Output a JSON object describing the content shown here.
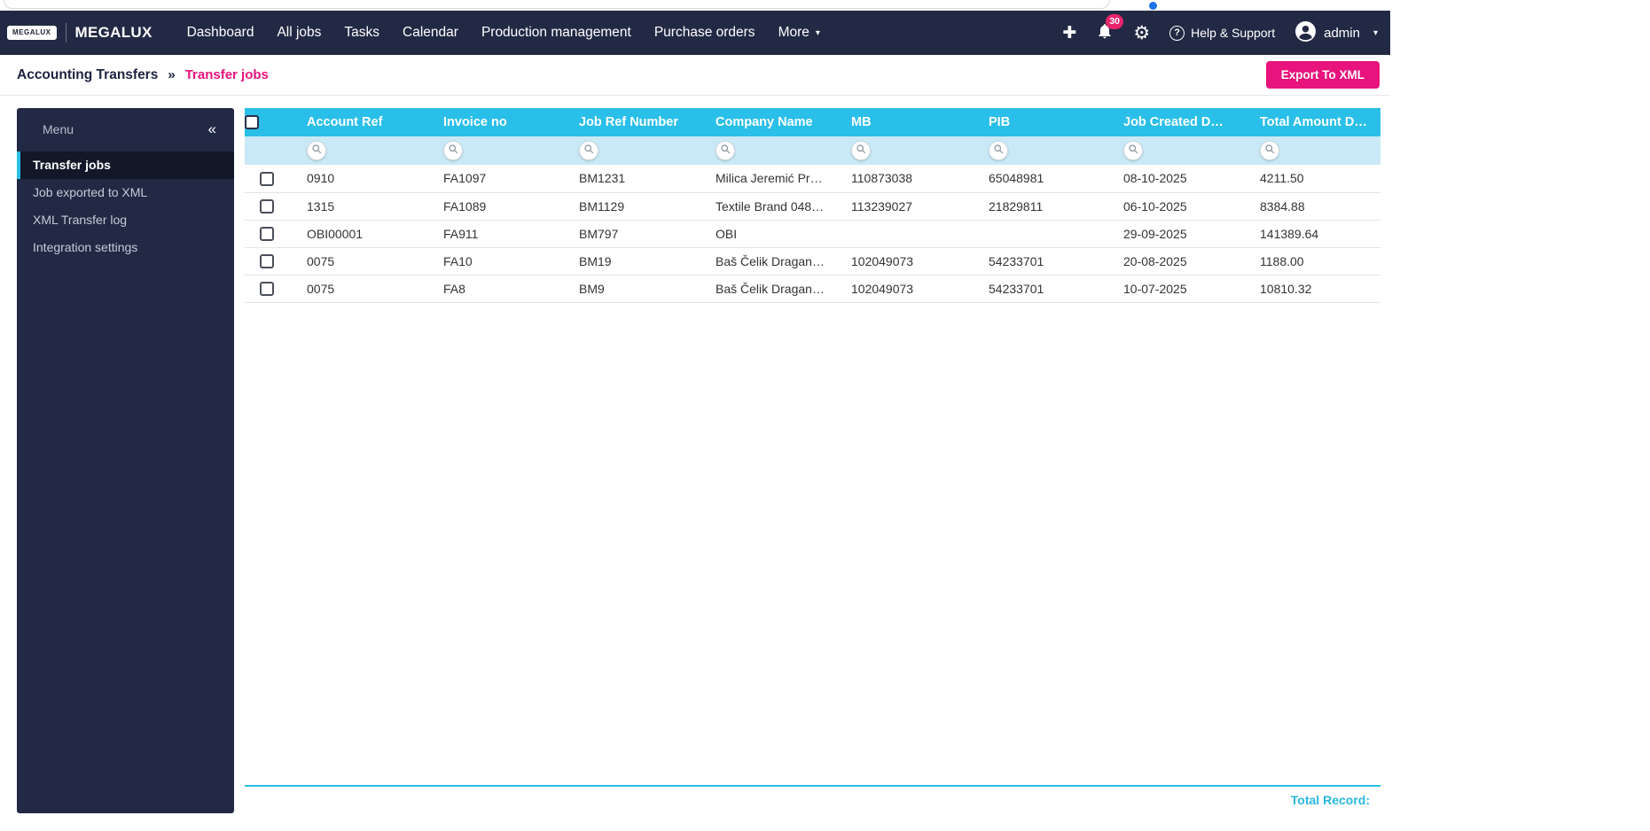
{
  "icons": {
    "plus": "✚",
    "gear": "⚙",
    "chevron_down": "▾",
    "collapse": "«",
    "breadcrumb_sep": "»",
    "help": "?"
  },
  "navbar": {
    "logo_badge": "MEGALUX",
    "brand": "MEGALUX",
    "items": [
      {
        "id": "dashboard",
        "label": "Dashboard"
      },
      {
        "id": "all-jobs",
        "label": "All jobs"
      },
      {
        "id": "tasks",
        "label": "Tasks"
      },
      {
        "id": "calendar",
        "label": "Calendar"
      },
      {
        "id": "production-management",
        "label": "Production management"
      },
      {
        "id": "purchase-orders",
        "label": "Purchase orders"
      },
      {
        "id": "more",
        "label": "More",
        "chevron": true
      }
    ],
    "notification_count": "30",
    "help_label": "Help & Support",
    "user_name": "admin"
  },
  "breadcrumb": {
    "parent": "Accounting Transfers",
    "current": "Transfer jobs"
  },
  "export_button_label": "Export To XML",
  "sidebar": {
    "title": "Menu",
    "items": [
      {
        "id": "transfer-jobs",
        "label": "Transfer jobs",
        "active": true
      },
      {
        "id": "job-exported-to-xml",
        "label": "Job exported to XML"
      },
      {
        "id": "xml-transfer-log",
        "label": "XML Transfer log"
      },
      {
        "id": "integration-settings",
        "label": "Integration settings"
      }
    ]
  },
  "table": {
    "columns": [
      "Account Ref",
      "Invoice no",
      "Job Ref Number",
      "Company Name",
      "MB",
      "PIB",
      "Job Created D…",
      "Total Amount D…"
    ],
    "rows": [
      {
        "cells": [
          "0910",
          "FA1097",
          "BM1231",
          "Milica Jeremić Pr…",
          "110873038",
          "65048981",
          "08-10-2025",
          "4211.50"
        ]
      },
      {
        "cells": [
          "1315",
          "FA1089",
          "BM1129",
          "Textile Brand 048…",
          "113239027",
          "21829811",
          "06-10-2025",
          "8384.88"
        ]
      },
      {
        "cells": [
          "OBI00001",
          "FA911",
          "BM797",
          "OBI",
          "",
          "",
          "29-09-2025",
          "141389.64"
        ]
      },
      {
        "cells": [
          "0075",
          "FA10",
          "BM19",
          "Baš Čelik Dragan…",
          "102049073",
          "54233701",
          "20-08-2025",
          "1188.00"
        ]
      },
      {
        "cells": [
          "0075",
          "FA8",
          "BM9",
          "Baš Čelik Dragan…",
          "102049073",
          "54233701",
          "10-07-2025",
          "10810.32"
        ]
      }
    ],
    "footer_label": "Total Record:"
  },
  "colors": {
    "navy": "#222944",
    "pink": "#e8137c",
    "cyan": "#29bfe8",
    "filter_bg": "#c9e9f6",
    "badge_pink": "#e8246c"
  }
}
